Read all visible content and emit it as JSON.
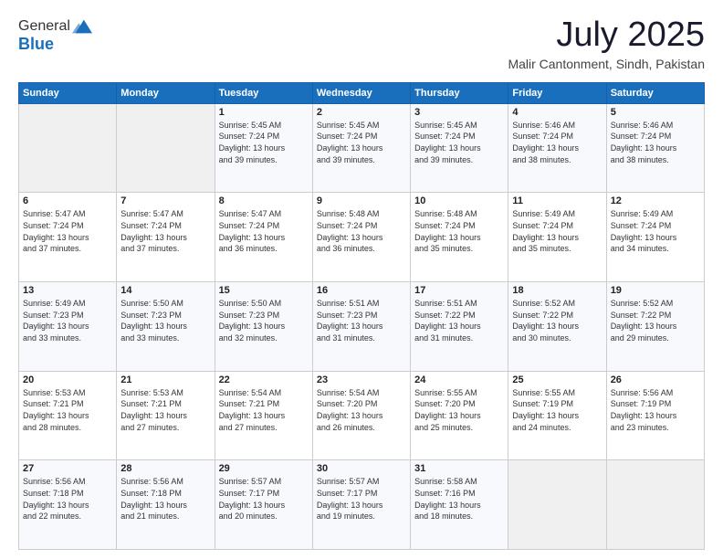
{
  "header": {
    "logo": {
      "line1": "General",
      "line2": "Blue"
    },
    "title": "July 2025",
    "location": "Malir Cantonment, Sindh, Pakistan"
  },
  "weekdays": [
    "Sunday",
    "Monday",
    "Tuesday",
    "Wednesday",
    "Thursday",
    "Friday",
    "Saturday"
  ],
  "weeks": [
    [
      {
        "day": "",
        "sunrise": "",
        "sunset": "",
        "daylight": ""
      },
      {
        "day": "",
        "sunrise": "",
        "sunset": "",
        "daylight": ""
      },
      {
        "day": "1",
        "sunrise": "Sunrise: 5:45 AM",
        "sunset": "Sunset: 7:24 PM",
        "daylight": "Daylight: 13 hours and 39 minutes."
      },
      {
        "day": "2",
        "sunrise": "Sunrise: 5:45 AM",
        "sunset": "Sunset: 7:24 PM",
        "daylight": "Daylight: 13 hours and 39 minutes."
      },
      {
        "day": "3",
        "sunrise": "Sunrise: 5:45 AM",
        "sunset": "Sunset: 7:24 PM",
        "daylight": "Daylight: 13 hours and 39 minutes."
      },
      {
        "day": "4",
        "sunrise": "Sunrise: 5:46 AM",
        "sunset": "Sunset: 7:24 PM",
        "daylight": "Daylight: 13 hours and 38 minutes."
      },
      {
        "day": "5",
        "sunrise": "Sunrise: 5:46 AM",
        "sunset": "Sunset: 7:24 PM",
        "daylight": "Daylight: 13 hours and 38 minutes."
      }
    ],
    [
      {
        "day": "6",
        "sunrise": "Sunrise: 5:47 AM",
        "sunset": "Sunset: 7:24 PM",
        "daylight": "Daylight: 13 hours and 37 minutes."
      },
      {
        "day": "7",
        "sunrise": "Sunrise: 5:47 AM",
        "sunset": "Sunset: 7:24 PM",
        "daylight": "Daylight: 13 hours and 37 minutes."
      },
      {
        "day": "8",
        "sunrise": "Sunrise: 5:47 AM",
        "sunset": "Sunset: 7:24 PM",
        "daylight": "Daylight: 13 hours and 36 minutes."
      },
      {
        "day": "9",
        "sunrise": "Sunrise: 5:48 AM",
        "sunset": "Sunset: 7:24 PM",
        "daylight": "Daylight: 13 hours and 36 minutes."
      },
      {
        "day": "10",
        "sunrise": "Sunrise: 5:48 AM",
        "sunset": "Sunset: 7:24 PM",
        "daylight": "Daylight: 13 hours and 35 minutes."
      },
      {
        "day": "11",
        "sunrise": "Sunrise: 5:49 AM",
        "sunset": "Sunset: 7:24 PM",
        "daylight": "Daylight: 13 hours and 35 minutes."
      },
      {
        "day": "12",
        "sunrise": "Sunrise: 5:49 AM",
        "sunset": "Sunset: 7:24 PM",
        "daylight": "Daylight: 13 hours and 34 minutes."
      }
    ],
    [
      {
        "day": "13",
        "sunrise": "Sunrise: 5:49 AM",
        "sunset": "Sunset: 7:23 PM",
        "daylight": "Daylight: 13 hours and 33 minutes."
      },
      {
        "day": "14",
        "sunrise": "Sunrise: 5:50 AM",
        "sunset": "Sunset: 7:23 PM",
        "daylight": "Daylight: 13 hours and 33 minutes."
      },
      {
        "day": "15",
        "sunrise": "Sunrise: 5:50 AM",
        "sunset": "Sunset: 7:23 PM",
        "daylight": "Daylight: 13 hours and 32 minutes."
      },
      {
        "day": "16",
        "sunrise": "Sunrise: 5:51 AM",
        "sunset": "Sunset: 7:23 PM",
        "daylight": "Daylight: 13 hours and 31 minutes."
      },
      {
        "day": "17",
        "sunrise": "Sunrise: 5:51 AM",
        "sunset": "Sunset: 7:22 PM",
        "daylight": "Daylight: 13 hours and 31 minutes."
      },
      {
        "day": "18",
        "sunrise": "Sunrise: 5:52 AM",
        "sunset": "Sunset: 7:22 PM",
        "daylight": "Daylight: 13 hours and 30 minutes."
      },
      {
        "day": "19",
        "sunrise": "Sunrise: 5:52 AM",
        "sunset": "Sunset: 7:22 PM",
        "daylight": "Daylight: 13 hours and 29 minutes."
      }
    ],
    [
      {
        "day": "20",
        "sunrise": "Sunrise: 5:53 AM",
        "sunset": "Sunset: 7:21 PM",
        "daylight": "Daylight: 13 hours and 28 minutes."
      },
      {
        "day": "21",
        "sunrise": "Sunrise: 5:53 AM",
        "sunset": "Sunset: 7:21 PM",
        "daylight": "Daylight: 13 hours and 27 minutes."
      },
      {
        "day": "22",
        "sunrise": "Sunrise: 5:54 AM",
        "sunset": "Sunset: 7:21 PM",
        "daylight": "Daylight: 13 hours and 27 minutes."
      },
      {
        "day": "23",
        "sunrise": "Sunrise: 5:54 AM",
        "sunset": "Sunset: 7:20 PM",
        "daylight": "Daylight: 13 hours and 26 minutes."
      },
      {
        "day": "24",
        "sunrise": "Sunrise: 5:55 AM",
        "sunset": "Sunset: 7:20 PM",
        "daylight": "Daylight: 13 hours and 25 minutes."
      },
      {
        "day": "25",
        "sunrise": "Sunrise: 5:55 AM",
        "sunset": "Sunset: 7:19 PM",
        "daylight": "Daylight: 13 hours and 24 minutes."
      },
      {
        "day": "26",
        "sunrise": "Sunrise: 5:56 AM",
        "sunset": "Sunset: 7:19 PM",
        "daylight": "Daylight: 13 hours and 23 minutes."
      }
    ],
    [
      {
        "day": "27",
        "sunrise": "Sunrise: 5:56 AM",
        "sunset": "Sunset: 7:18 PM",
        "daylight": "Daylight: 13 hours and 22 minutes."
      },
      {
        "day": "28",
        "sunrise": "Sunrise: 5:56 AM",
        "sunset": "Sunset: 7:18 PM",
        "daylight": "Daylight: 13 hours and 21 minutes."
      },
      {
        "day": "29",
        "sunrise": "Sunrise: 5:57 AM",
        "sunset": "Sunset: 7:17 PM",
        "daylight": "Daylight: 13 hours and 20 minutes."
      },
      {
        "day": "30",
        "sunrise": "Sunrise: 5:57 AM",
        "sunset": "Sunset: 7:17 PM",
        "daylight": "Daylight: 13 hours and 19 minutes."
      },
      {
        "day": "31",
        "sunrise": "Sunrise: 5:58 AM",
        "sunset": "Sunset: 7:16 PM",
        "daylight": "Daylight: 13 hours and 18 minutes."
      },
      {
        "day": "",
        "sunrise": "",
        "sunset": "",
        "daylight": ""
      },
      {
        "day": "",
        "sunrise": "",
        "sunset": "",
        "daylight": ""
      }
    ]
  ]
}
